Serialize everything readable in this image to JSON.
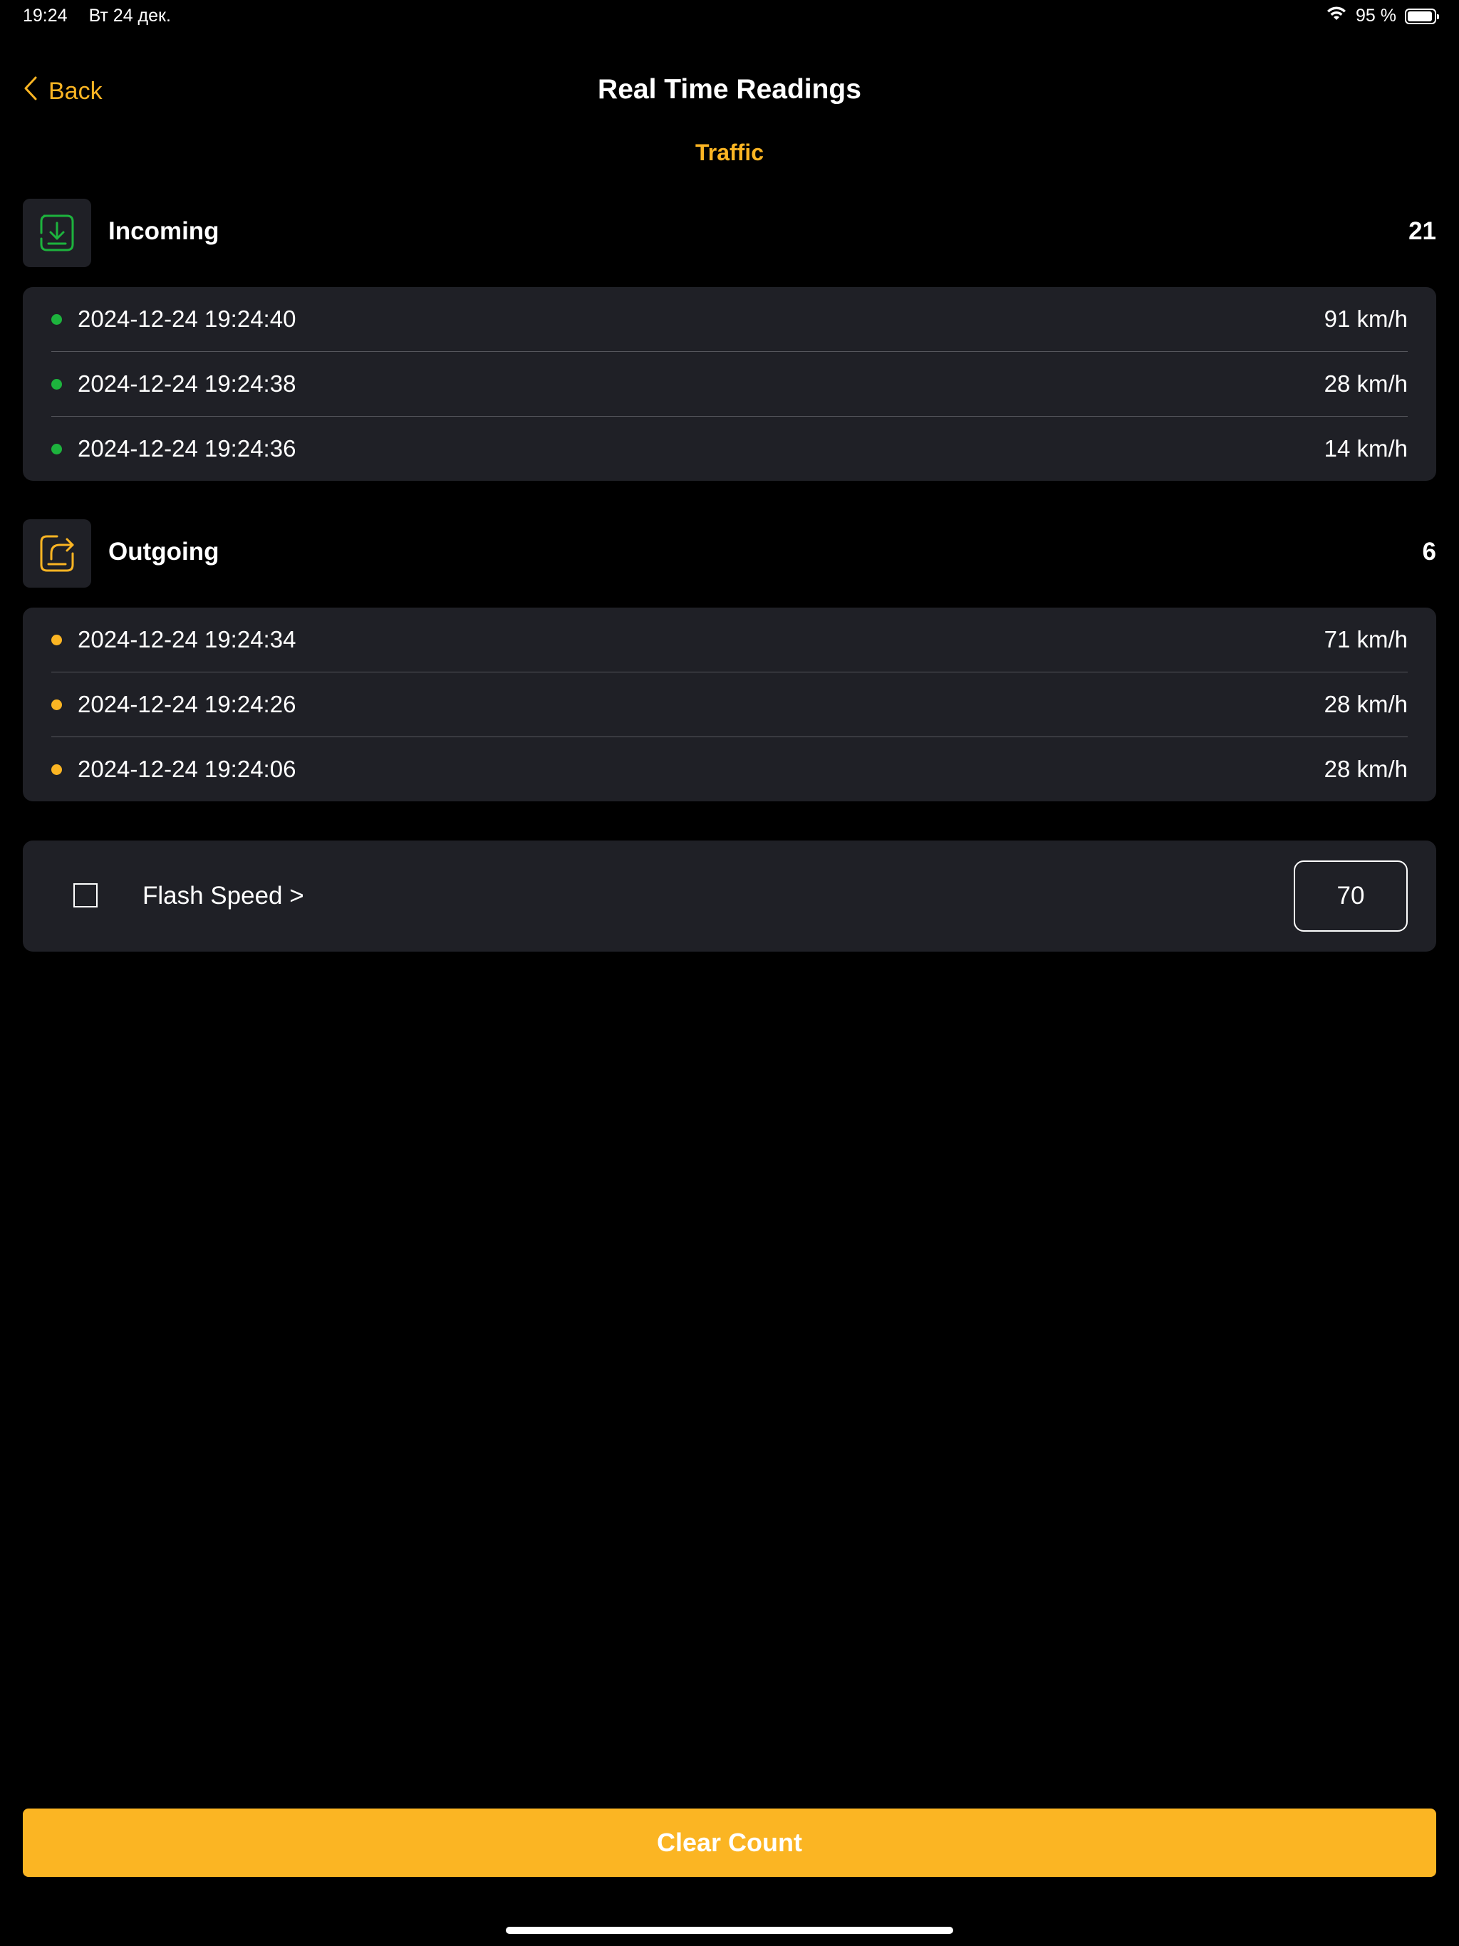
{
  "status_bar": {
    "time": "19:24",
    "date": "Вт 24 дек.",
    "battery_percent": "95 %",
    "battery_level": 0.95
  },
  "nav": {
    "back_label": "Back",
    "title": "Real Time Readings"
  },
  "segment_title": "Traffic",
  "colors": {
    "accent": "#fbb523",
    "incoming": "#1db33d",
    "outgoing": "#fbb523",
    "card_bg": "#1f2026"
  },
  "incoming": {
    "title": "Incoming",
    "count": "21",
    "icon": "download-tray-icon",
    "rows": [
      {
        "time": "2024-12-24 19:24:40",
        "speed": "91 km/h"
      },
      {
        "time": "2024-12-24 19:24:38",
        "speed": "28 km/h"
      },
      {
        "time": "2024-12-24 19:24:36",
        "speed": "14 km/h"
      }
    ]
  },
  "outgoing": {
    "title": "Outgoing",
    "count": "6",
    "icon": "share-tray-icon",
    "rows": [
      {
        "time": "2024-12-24 19:24:34",
        "speed": "71 km/h"
      },
      {
        "time": "2024-12-24 19:24:26",
        "speed": "28 km/h"
      },
      {
        "time": "2024-12-24 19:24:06",
        "speed": "28 km/h"
      }
    ]
  },
  "flash": {
    "label": "Flash Speed >",
    "checked": false,
    "value": "70"
  },
  "clear_label": "Clear Count"
}
